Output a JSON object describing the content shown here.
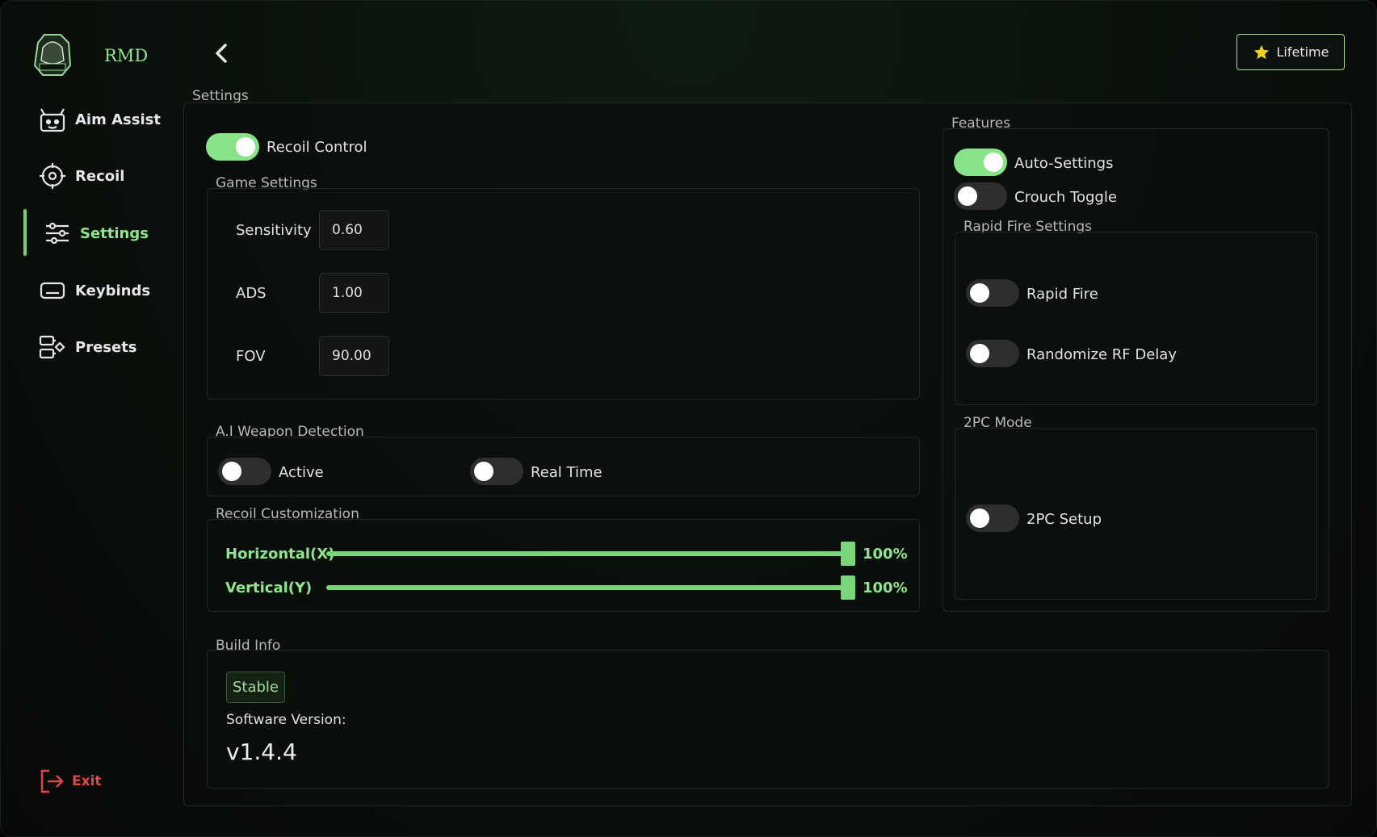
{
  "brand": {
    "name": "RMD"
  },
  "sidebar": {
    "items": [
      {
        "label": "Aim Assist",
        "icon": "robot-icon"
      },
      {
        "label": "Recoil",
        "icon": "crosshair-icon"
      },
      {
        "label": "Settings",
        "icon": "sliders-icon",
        "active": true
      },
      {
        "label": "Keybinds",
        "icon": "keyboard-icon"
      },
      {
        "label": "Presets",
        "icon": "presets-icon"
      }
    ],
    "exit_label": "Exit"
  },
  "header": {
    "lifetime_label": "Lifetime"
  },
  "settings": {
    "title": "Settings",
    "recoil_control": {
      "label": "Recoil Control",
      "on": true
    },
    "game_settings": {
      "title": "Game Settings",
      "sensitivity_label": "Sensitivity",
      "sensitivity": "0.60",
      "ads_label": "ADS",
      "ads": "1.00",
      "fov_label": "FOV",
      "fov": "90.00"
    },
    "ai_detection": {
      "title": "A.I Weapon Detection",
      "active_label": "Active",
      "active_on": false,
      "realtime_label": "Real Time",
      "realtime_on": false
    },
    "recoil_custom": {
      "title": "Recoil Customization",
      "horizontal_label": "Horizontal(X)",
      "horizontal_value": "100%",
      "horizontal_fraction": 1.0,
      "vertical_label": "Vertical(Y)",
      "vertical_value": "100%",
      "vertical_fraction": 1.0
    },
    "build_info": {
      "title": "Build Info",
      "channel": "Stable",
      "version_label": "Software Version:",
      "version": "v1.4.4"
    }
  },
  "features": {
    "title": "Features",
    "auto_settings": {
      "label": "Auto-Settings",
      "on": true
    },
    "crouch_toggle": {
      "label": "Crouch Toggle",
      "on": false
    },
    "rapid_fire_settings": {
      "title": "Rapid Fire Settings",
      "rapid_fire": {
        "label": "Rapid Fire",
        "on": false
      },
      "randomize": {
        "label": "Randomize RF Delay",
        "on": false
      }
    },
    "two_pc": {
      "title": "2PC Mode",
      "setup": {
        "label": "2PC Setup",
        "on": false
      }
    }
  },
  "colors": {
    "accent": "#88e488",
    "exit": "#e04848",
    "background": "#0a100b"
  }
}
